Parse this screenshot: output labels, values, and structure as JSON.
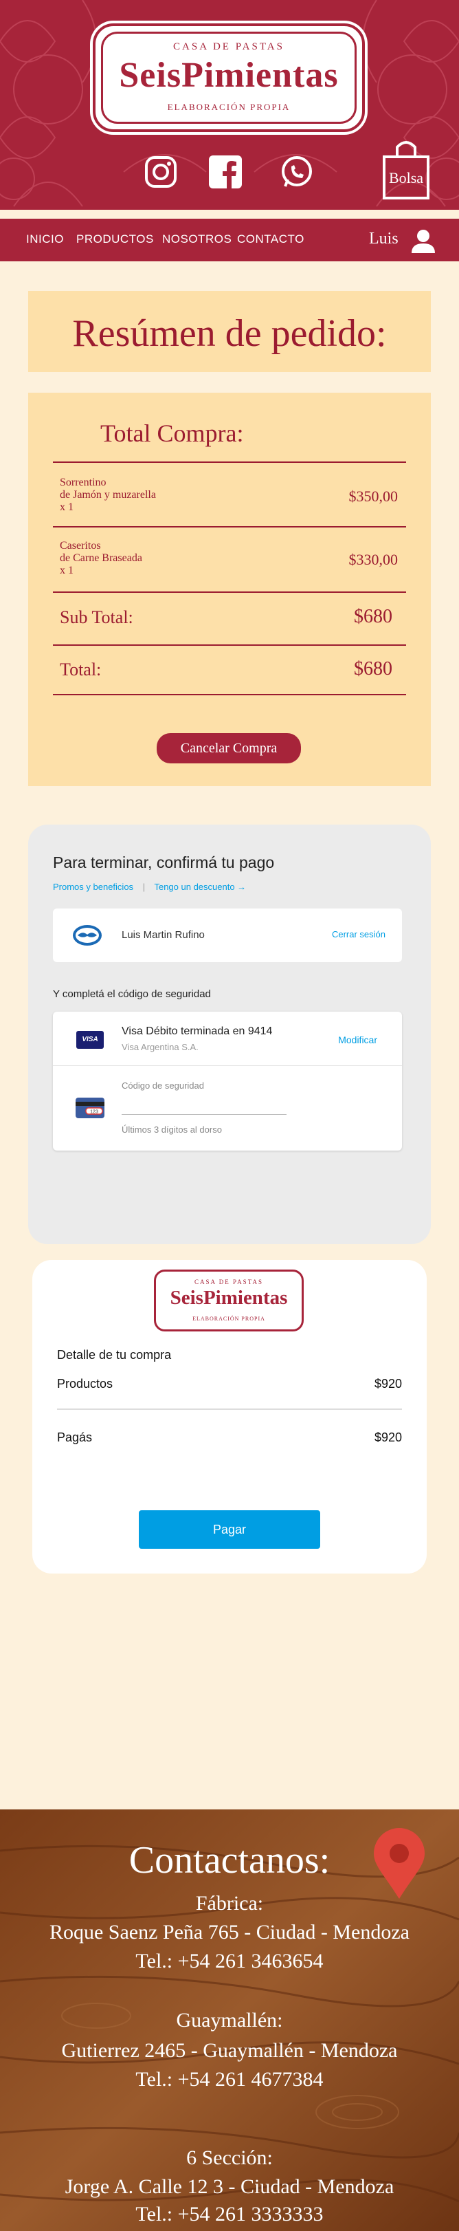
{
  "brand": {
    "top": "CASA DE PASTAS",
    "name": "SeisPimientas",
    "bottom": "ELABORACIÓN PROPIA"
  },
  "header": {
    "bag_label": "Bolsa",
    "social_icons": [
      "instagram-icon",
      "facebook-icon",
      "whatsapp-icon"
    ]
  },
  "nav": {
    "items": [
      "INICIO",
      "PRODUCTOS",
      "NOSOTROS",
      "CONTACTO"
    ],
    "user": "Luis"
  },
  "order": {
    "title": "Resúmen de pedido:",
    "total_heading": "Total Compra:",
    "items": [
      {
        "line1": "Sorrentino",
        "line2": "de Jamón y muzarella",
        "qty": "x 1",
        "price": "$350,00"
      },
      {
        "line1": "Caseritos",
        "line2": "de Carne Braseada",
        "qty": "x 1",
        "price": "$330,00"
      }
    ],
    "subtotal_label": "Sub Total:",
    "subtotal_value": "$680",
    "total_label": "Total:",
    "total_value": "$680",
    "cancel_label": "Cancelar Compra"
  },
  "payment": {
    "title": "Para terminar, confirmá tu pago",
    "link_promos": "Promos y beneficios",
    "link_discount": "Tengo un descuento →",
    "user_name": "Luis Martin Rufino",
    "logout_label": "Cerrar sesión",
    "security_title": "Y completá el código de seguridad",
    "card_name": "Visa Débito terminada en 9414",
    "card_bank": "Visa Argentina S.A.",
    "card_brand": "VISA",
    "modify_label": "Modificar",
    "cvv_label": "Código de seguridad",
    "cvv_value": "",
    "cvv_hint": "Últimos 3 dígitos al dorso",
    "cvv_icon_text": "123"
  },
  "receipt": {
    "title": "Detalle de tu compra",
    "products_label": "Productos",
    "products_value": "$920",
    "paid_label": "Pagás",
    "paid_value": "$920",
    "pay_button": "Pagar"
  },
  "footer": {
    "title": "Contactanos:",
    "lines": [
      "Fábrica:",
      "Roque Saenz Peña 765 - Ciudad - Mendoza",
      "Tel.: +54 261 3463654",
      "Guaymallén:",
      "Gutierrez 2465 - Guaymallén - Mendoza",
      "Tel.: +54 261 4677384",
      "6 Sección:",
      "Jorge A. Calle 12 3 - Ciudad - Mendoza",
      "Tel.: +54 261 3333333"
    ]
  },
  "colors": {
    "brand_red": "#a7243a",
    "cream": "#fdf1dc",
    "panel": "#fde0a9",
    "mp_blue": "#009ee3"
  }
}
